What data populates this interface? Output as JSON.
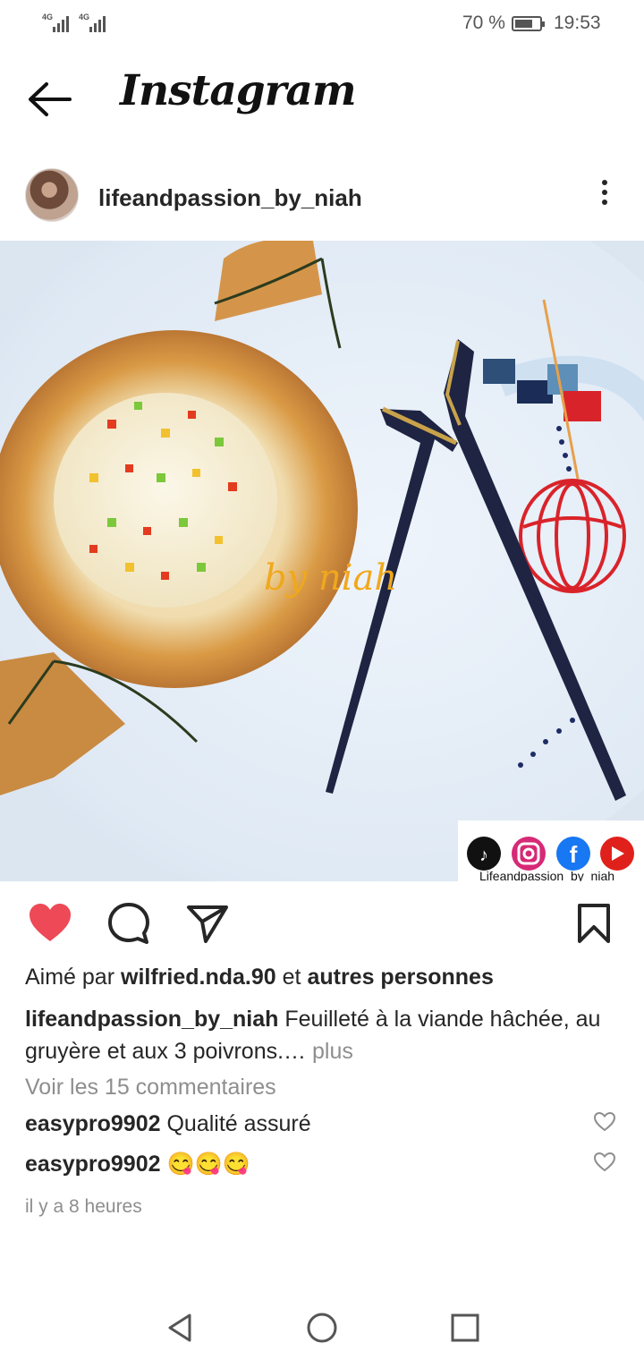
{
  "status_bar": {
    "network_1": "4G",
    "network_2": "4G",
    "battery": "70 %",
    "battery_level": 0.7,
    "time": "19:53"
  },
  "header": {
    "title": "Instagram",
    "back_icon": "arrow-left-icon"
  },
  "post": {
    "username": "lifeandpassion_by_niah",
    "more_icon": "more-vertical-icon",
    "photo": {
      "watermark": "by niah",
      "social_tag": "Lifeandpassion_by_niah",
      "social_icons": [
        "tiktok-icon",
        "instagram-icon",
        "facebook-icon",
        "youtube-icon"
      ]
    },
    "actions": {
      "like_icon": "heart-filled-icon",
      "like_color": "#ed4956",
      "comment_icon": "comment-icon",
      "share_icon": "send-icon",
      "save_icon": "bookmark-icon"
    },
    "likes": {
      "prefix": "Aimé par",
      "user": "wilfried.nda.90",
      "connector": "et",
      "others": "autres personnes"
    },
    "caption": {
      "user": "lifeandpassion_by_niah",
      "text": "Feuilleté à la viande hâchée, au gruyère et aux 3 poivrons.…",
      "more": "plus"
    },
    "view_comments": "Voir les 15 commentaires",
    "comments": [
      {
        "user": "easypro9902",
        "text": "Qualité assuré"
      },
      {
        "user": "easypro9902",
        "text": "😋😋😋"
      }
    ],
    "timestamp": "il y a 8 heures"
  },
  "nav_bar": {
    "back": "triangle-back-icon",
    "home": "circle-home-icon",
    "recents": "square-recents-icon"
  }
}
